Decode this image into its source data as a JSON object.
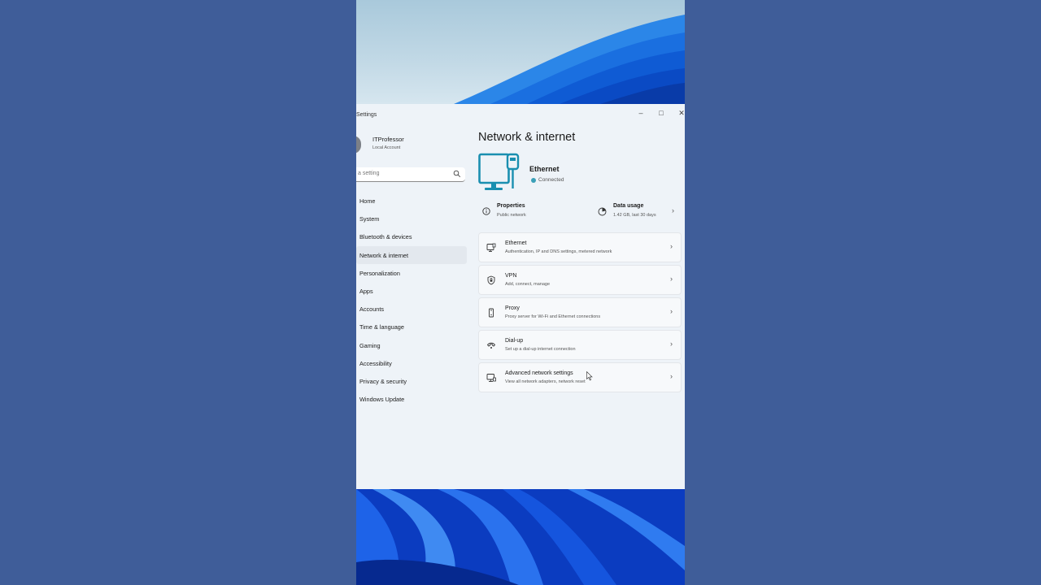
{
  "window": {
    "title": "Settings",
    "controls": {
      "minimize": "–",
      "maximize": "□",
      "close": "✕"
    }
  },
  "profile": {
    "name": "ITProfessor",
    "account": "Local Account",
    "avatar_icon": "user-avatar-icon"
  },
  "search": {
    "placeholder": "a setting",
    "icon": "search-icon"
  },
  "sidebar": {
    "active_index": 3,
    "items": [
      {
        "label": "Home"
      },
      {
        "label": "System"
      },
      {
        "label": "Bluetooth & devices"
      },
      {
        "label": "Network & internet"
      },
      {
        "label": "Personalization"
      },
      {
        "label": "Apps"
      },
      {
        "label": "Accounts"
      },
      {
        "label": "Time & language"
      },
      {
        "label": "Gaming"
      },
      {
        "label": "Accessibility"
      },
      {
        "label": "Privacy & security"
      },
      {
        "label": "Windows Update"
      }
    ]
  },
  "main": {
    "title": "Network & internet",
    "hero": {
      "icon": "ethernet-monitor-icon",
      "name": "Ethernet",
      "status": "Connected",
      "status_color": "#3aa0b8"
    },
    "properties": {
      "title": "Properties",
      "subtitle": "Public network",
      "icon": "info-icon"
    },
    "data_usage": {
      "title": "Data usage",
      "subtitle": "1.42 GB, last 30 days",
      "icon": "data-usage-icon"
    },
    "cards": [
      {
        "title": "Ethernet",
        "subtitle": "Authentication, IP and DNS settings, metered network",
        "icon": "ethernet-icon"
      },
      {
        "title": "VPN",
        "subtitle": "Add, connect, manage",
        "icon": "shield-icon"
      },
      {
        "title": "Proxy",
        "subtitle": "Proxy server for Wi-Fi and Ethernet connections",
        "icon": "proxy-icon"
      },
      {
        "title": "Dial-up",
        "subtitle": "Set up a dial-up internet connection",
        "icon": "dial-up-icon"
      },
      {
        "title": "Advanced network settings",
        "subtitle": "View all network adapters, network reset",
        "icon": "network-adapter-icon"
      }
    ]
  },
  "colors": {
    "accent": "#0067c0",
    "hero_icon": "#1a8fb0",
    "outer_background": "#3f5d99",
    "window_background": "#eef3f8"
  }
}
